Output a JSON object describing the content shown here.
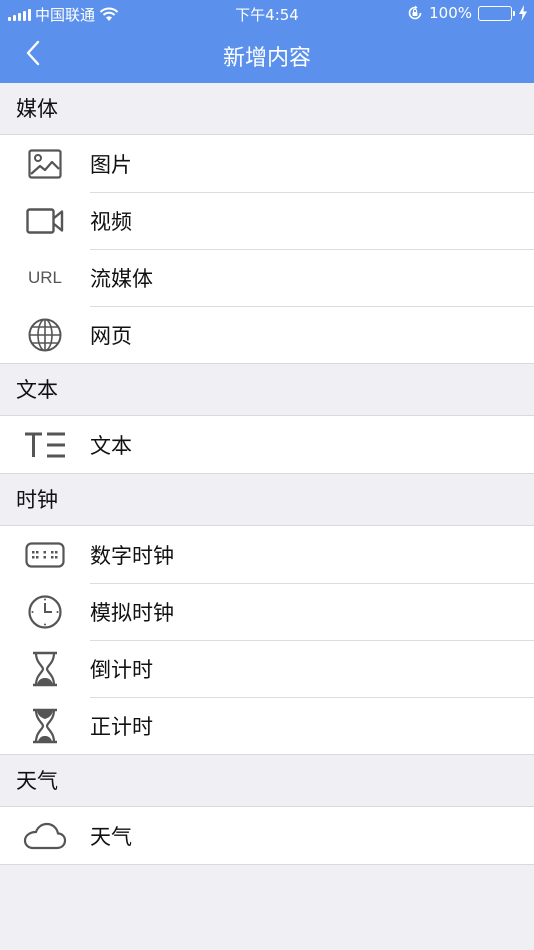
{
  "status_bar": {
    "carrier": "中国联通",
    "time": "下午4:54",
    "battery": "100%"
  },
  "navbar": {
    "title": "新增内容"
  },
  "sections": [
    {
      "header": "媒体",
      "items": [
        {
          "label": "图片",
          "icon": "image-icon"
        },
        {
          "label": "视频",
          "icon": "video-icon"
        },
        {
          "label": "流媒体",
          "icon": "url-icon",
          "icon_text": "URL"
        },
        {
          "label": "网页",
          "icon": "globe-icon"
        }
      ]
    },
    {
      "header": "文本",
      "items": [
        {
          "label": "文本",
          "icon": "text-icon"
        }
      ]
    },
    {
      "header": "时钟",
      "items": [
        {
          "label": "数字时钟",
          "icon": "digital-clock-icon"
        },
        {
          "label": "模拟时钟",
          "icon": "analog-clock-icon"
        },
        {
          "label": "倒计时",
          "icon": "hourglass-down-icon"
        },
        {
          "label": "正计时",
          "icon": "hourglass-up-icon"
        }
      ]
    },
    {
      "header": "天气",
      "items": [
        {
          "label": "天气",
          "icon": "cloud-icon"
        }
      ]
    }
  ],
  "colors": {
    "nav_bg": "#5b91ec",
    "page_bg": "#efeff4",
    "battery_fill": "#5ad24e"
  }
}
